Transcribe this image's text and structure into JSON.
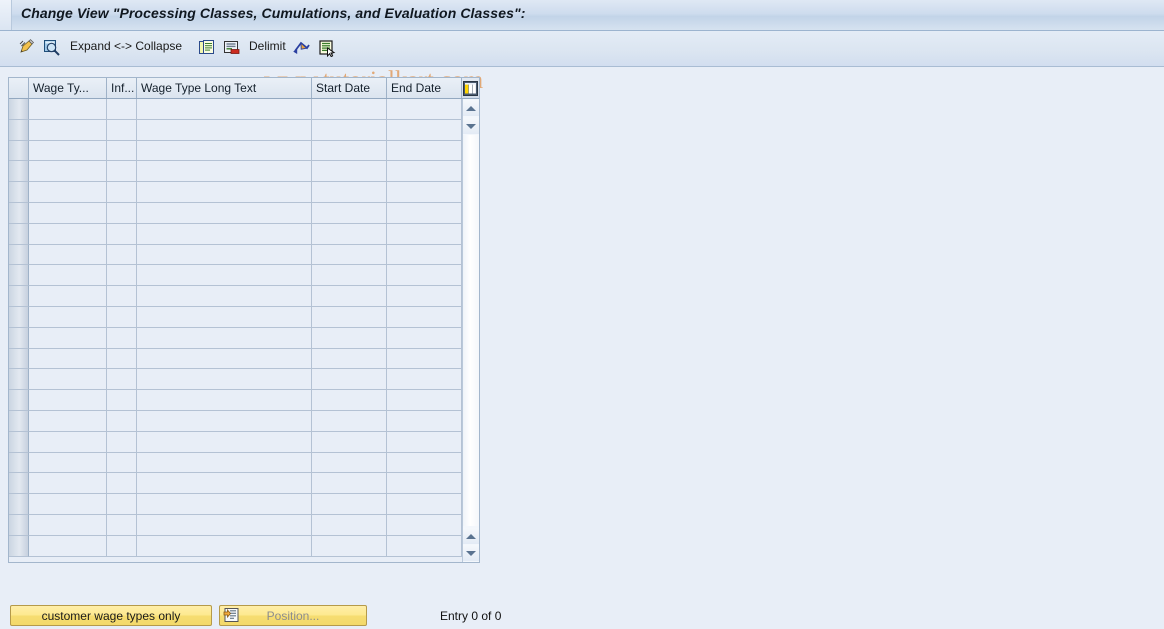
{
  "window": {
    "title": "Change View \"Processing Classes, Cumulations, and Evaluation Classes\":"
  },
  "watermark": {
    "text": "www.tutorialkart.com",
    "color": "#e09a5c"
  },
  "toolbar": {
    "items": [
      {
        "name": "edit-pencil-icon",
        "label": ""
      },
      {
        "name": "display-magnifier-icon",
        "label": ""
      },
      {
        "name": "expand-collapse-button",
        "label": "Expand <-> Collapse"
      },
      {
        "name": "copy-as-icon",
        "label": ""
      },
      {
        "name": "delete-row-icon",
        "label": ""
      },
      {
        "name": "delimit-button",
        "label": "Delimit"
      },
      {
        "name": "undo-icon",
        "label": ""
      },
      {
        "name": "select-details-icon",
        "label": ""
      }
    ],
    "expand_collapse_label": "Expand <-> Collapse",
    "delimit_label": "Delimit"
  },
  "table": {
    "columns": [
      {
        "key": "sel",
        "label": ""
      },
      {
        "key": "wage_type",
        "label": "Wage Ty..."
      },
      {
        "key": "infotype",
        "label": "Inf..."
      },
      {
        "key": "long_text",
        "label": "Wage Type Long Text"
      },
      {
        "key": "start_date",
        "label": "Start Date"
      },
      {
        "key": "end_date",
        "label": "End Date"
      }
    ],
    "rows": [],
    "empty_row_count": 22,
    "config_icon": "table-settings-icon"
  },
  "scrollbar": {
    "up_icon": "scroll-up-arrow-icon",
    "down_icon": "scroll-down-arrow-icon"
  },
  "footer": {
    "customer_button_label": "customer wage types only",
    "position_button_label": "Position...",
    "position_icon": "position-icon",
    "entry_status": "Entry 0 of 0"
  },
  "colors": {
    "background": "#e8eef7",
    "title_bar": "#cedcee",
    "accent_yellow": "#f6dd72",
    "grid_line": "#b4c2d4"
  }
}
